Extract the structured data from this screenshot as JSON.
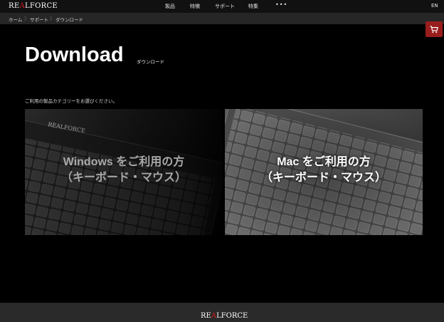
{
  "header": {
    "logo": {
      "pre": "RE",
      "accent": "A",
      "post": "LFORCE"
    },
    "nav": [
      "製品",
      "特徴",
      "サポート",
      "特集"
    ],
    "more": "•••",
    "lang": "EN"
  },
  "breadcrumb": [
    "ホーム",
    "サポート",
    "ダウンロード"
  ],
  "page": {
    "title": "Download",
    "subtitle": "ダウンロード",
    "prompt": "ご利用の製品カテゴリーをお選びください。"
  },
  "cards": [
    {
      "line1": "Windows をご利用の方",
      "line2": "（キーボード・マウス）"
    },
    {
      "line1": "Mac をご利用の方",
      "line2": "（キーボード・マウス）"
    }
  ],
  "footer": {
    "logo": {
      "pre": "RE",
      "accent": "A",
      "post": "LFORCE"
    }
  },
  "colors": {
    "accent": "#d21c1c",
    "cart": "#9a1d1d"
  },
  "icons": {
    "cart": "cart-icon"
  }
}
